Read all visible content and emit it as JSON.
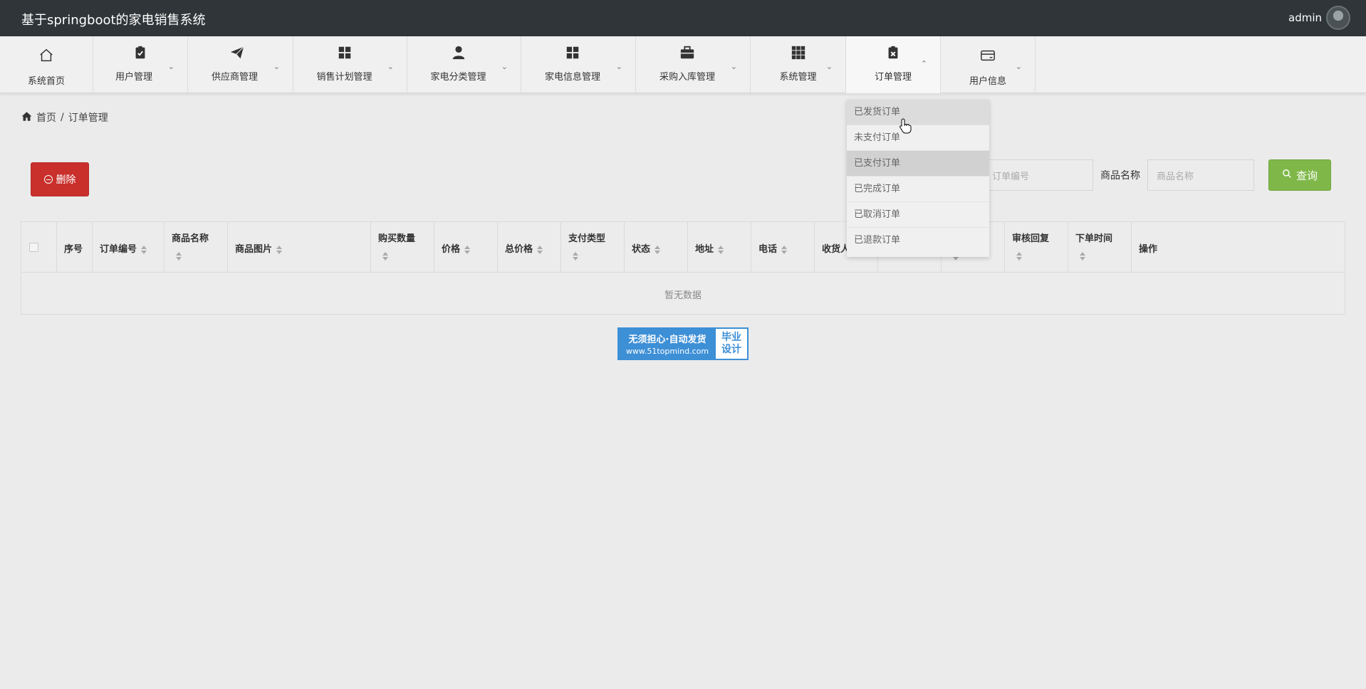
{
  "header": {
    "title": "基于springboot的家电销售系统",
    "user": "admin"
  },
  "nav": [
    {
      "label": "系统首页",
      "icon": "home-icon"
    },
    {
      "label": "用户管理",
      "icon": "clipboard-check-icon"
    },
    {
      "label": "供应商管理",
      "icon": "paper-plane-icon"
    },
    {
      "label": "销售计划管理",
      "icon": "grid-icon"
    },
    {
      "label": "家电分类管理",
      "icon": "user-icon"
    },
    {
      "label": "家电信息管理",
      "icon": "grid-icon"
    },
    {
      "label": "采购入库管理",
      "icon": "briefcase-icon"
    },
    {
      "label": "系统管理",
      "icon": "apps-grid-icon"
    },
    {
      "label": "订单管理",
      "icon": "clipboard-x-icon"
    },
    {
      "label": "用户信息",
      "icon": "card-icon"
    }
  ],
  "breadcrumb": {
    "home": "首页",
    "separator": "/",
    "current": "订单管理"
  },
  "toolbar": {
    "delete_label": "删除"
  },
  "search": {
    "order_no_placeholder": "订单编号",
    "product_label": "商品名称",
    "product_placeholder": "商品名称",
    "query_label": "查询"
  },
  "table": {
    "columns": [
      "序号",
      "订单编号",
      "商品名称",
      "商品图片",
      "购买数量",
      "价格",
      "总价格",
      "支付类型",
      "状态",
      "地址",
      "电话",
      "收货人",
      "审核回复",
      "下单时间",
      "操作"
    ],
    "empty_text": "暂无数据"
  },
  "dropdown": {
    "items": [
      "已发货订单",
      "未支付订单",
      "已支付订单",
      "已完成订单",
      "已取消订单",
      "已退款订单"
    ]
  },
  "promo": {
    "line1": "无须担心·自动发货",
    "line2": "www.51topmind.com",
    "right1": "毕业",
    "right2": "设计"
  },
  "colors": {
    "header_bg": "#2f3538",
    "delete_bg": "#c9302c",
    "query_bg": "#7fb849",
    "promo_blue": "#3d8fd6"
  }
}
